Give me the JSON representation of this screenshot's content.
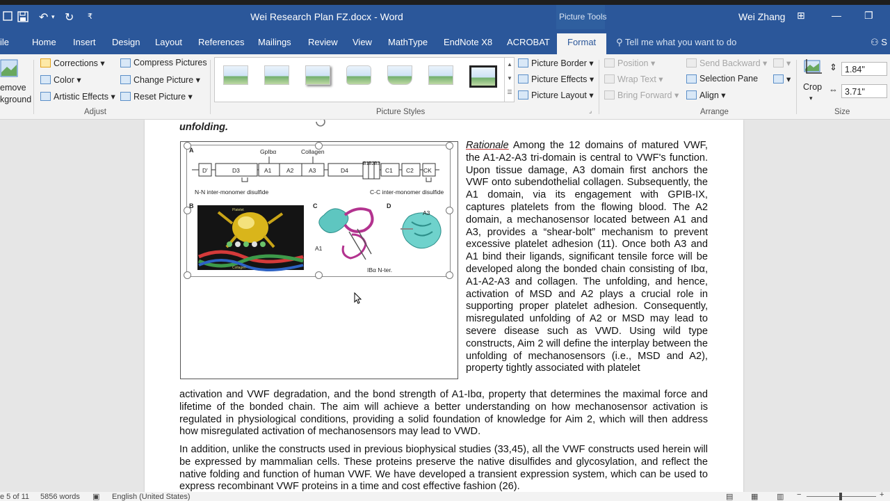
{
  "titlebar": {
    "document_title": "Wei Research Plan FZ.docx  -  Word",
    "contextual_group": "Picture Tools",
    "user": "Wei Zhang",
    "customize_glyph": "₹",
    "undo_glyph": "↶",
    "redo_glyph": "↻",
    "minimize_glyph": "—",
    "restore_glyph": "❐",
    "ribbon_display_glyph": "⊞"
  },
  "tabs": [
    "ile",
    "Home",
    "Insert",
    "Design",
    "Layout",
    "References",
    "Mailings",
    "Review",
    "View",
    "MathType",
    "EndNote X8",
    "ACROBAT",
    "Format"
  ],
  "tell_me": "Tell me what you want to do",
  "share_label": "S",
  "ribbon": {
    "remove_bg": [
      "emove",
      "kground"
    ],
    "adjust": {
      "corrections": "Corrections",
      "color": "Color",
      "artistic": "Artistic Effects",
      "compress": "Compress Pictures",
      "change": "Change Picture",
      "reset": "Reset Picture",
      "group": "Adjust"
    },
    "styles": {
      "border": "Picture Border",
      "effects": "Picture Effects",
      "layout": "Picture Layout",
      "group": "Picture Styles"
    },
    "arrange": {
      "position": "Position",
      "wrap": "Wrap Text",
      "bring": "Bring Forward",
      "send": "Send Backward",
      "pane": "Selection Pane",
      "align": "Align",
      "group": "Arrange"
    },
    "size": {
      "crop": "Crop",
      "height": "1.84\"",
      "width": "3.71\"",
      "group": "Size"
    }
  },
  "document": {
    "heading": "unfolding.",
    "figure": {
      "A": "A",
      "B": "B",
      "C": "C",
      "D": "D",
      "gp": "GpIbα",
      "collagen": "Collagen",
      "domains": [
        "D'",
        "D3",
        "A1",
        "A2",
        "A3",
        "D4",
        "B1",
        "B2",
        "B3",
        "C1",
        "C2",
        "CK"
      ],
      "nn": "N-N inter-monomer disulfide",
      "cc": "C-C inter-monomer disulfide",
      "a1": "A1",
      "ib": "IBα N-ter.",
      "a3": "A3",
      "platelet": "Platelet",
      "collagen_small": "Collagen"
    },
    "wrap_para": {
      "rationale": "Rationale",
      "text": "  Among the 12 domains of matured VWF, the A1-A2-A3 tri-domain is central to VWF's function. Upon tissue damage, A3 domain first anchors the VWF onto subendothelial collagen. Subsequently, the A1 domain, via its engagement with GPIB-IX, captures platelets from the flowing blood. The A2 domain, a mechanosensor located between A1 and A3, provides a “shear-bolt” mechanism to prevent excessive platelet adhesion (11). Once both A3 and A1 bind their ligands, significant tensile force will be developed along the bonded chain consisting of Ibα, A1-A2-A3 and collagen. The unfolding, and hence, activation of MSD and A2 plays a crucial role in supporting proper platelet adhesion. Consequently, misregulated unfolding of A2 or MSD may lead to severe disease such as VWD. Using wild type constructs, Aim 2 will define the interplay between the unfolding of mechanosensors (i.e., MSD and A2), property tightly associated with platelet"
    },
    "full_para": "activation and VWF degradation, and the bond strength of A1-Ibα, property that determines the maximal force and lifetime of the bonded chain. The aim will achieve a better understanding on how mechanosensor activation is regulated in physiological conditions, providing a solid foundation of knowledge for Aim 2, which will then address how misregulated activation of mechanosensors may lead to VWD.",
    "para2": "In addition, unlike the constructs used in previous biophysical studies (33,45), all the VWF constructs used herein will be expressed by mammalian cells. These proteins preserve the native disulfides and glycosylation, and reflect the native folding and function of human VWF. We have developed a transient expression system, which can be used to express recombinant VWF proteins in a time and cost effective fashion (26)."
  },
  "status": {
    "page": "e 5 of 11",
    "words": "5856 words",
    "language": "English (United States)"
  }
}
